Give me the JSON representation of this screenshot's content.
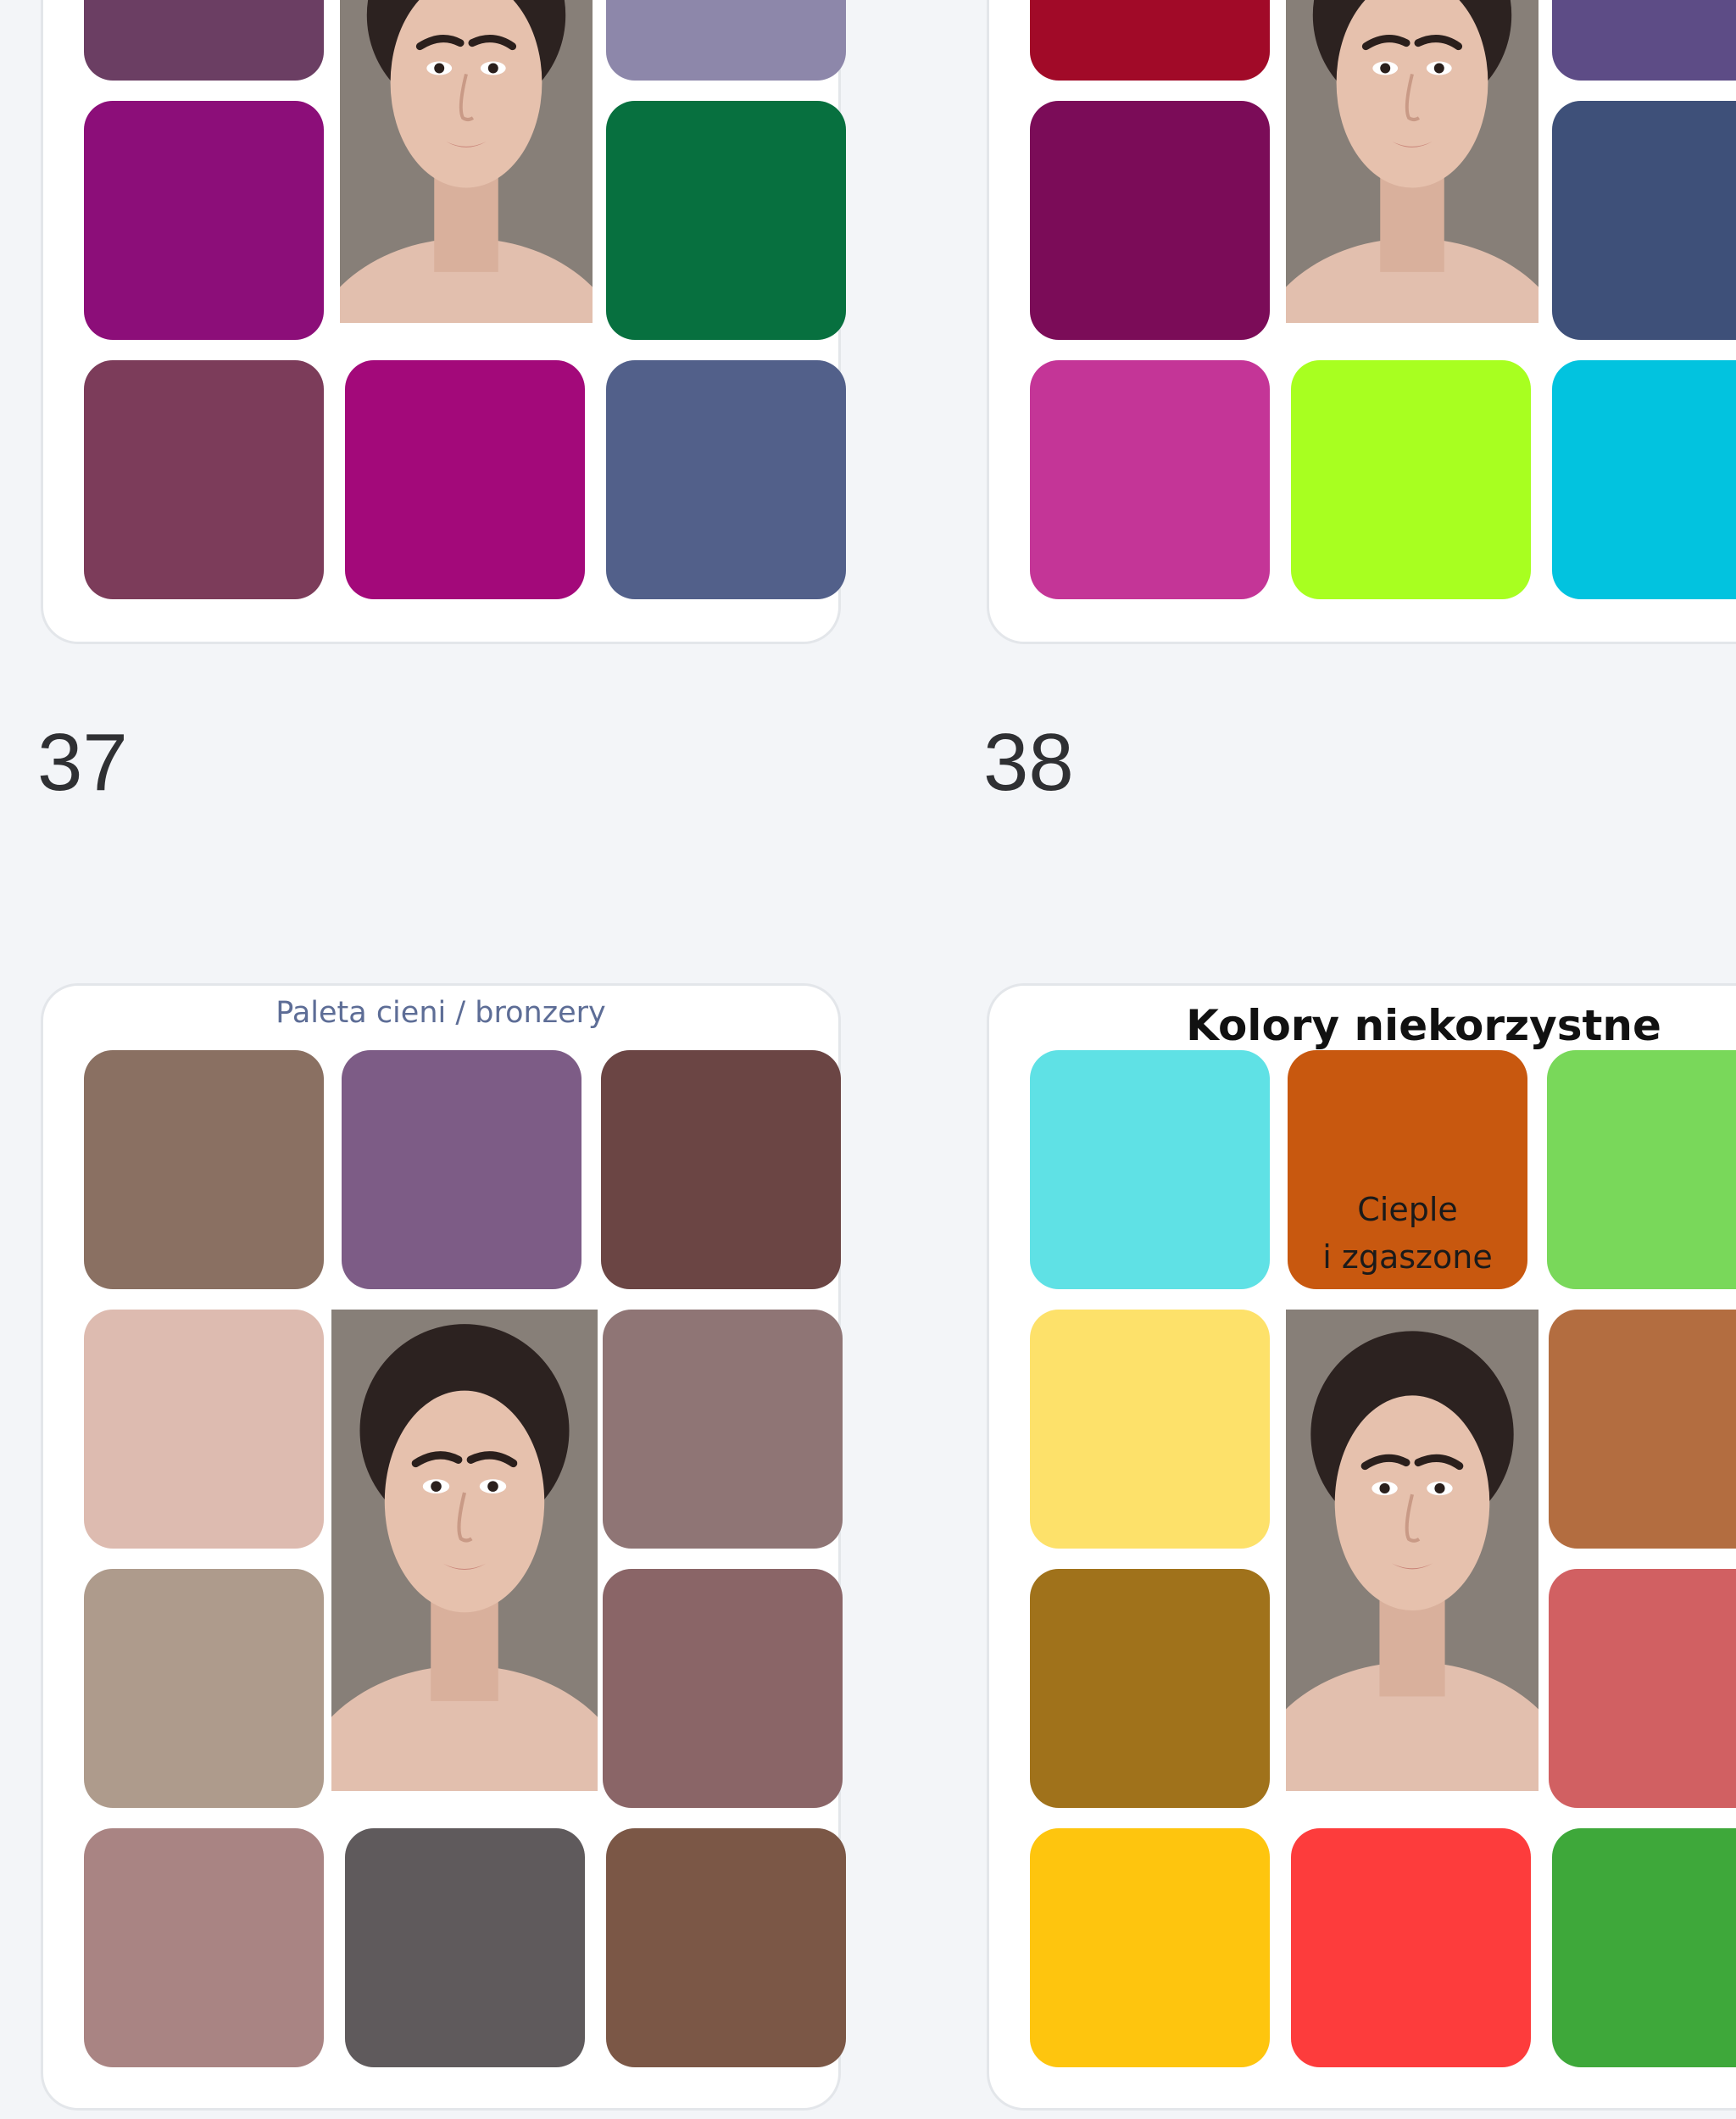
{
  "cards": {
    "top_left": {
      "swatches": [
        "#6b3e63",
        "#8d87aa",
        "#8c0e79",
        "#07703f",
        "#7c3c5a",
        "#a3097a",
        "#52608a"
      ]
    },
    "top_right": {
      "swatches": [
        "#a10a28",
        "#5d4c86",
        "#7b0c58",
        "#3e5079",
        "#c43597",
        "#a8ff20",
        "#02c3df"
      ]
    },
    "bottom_left": {
      "number": "37",
      "title": "Paleta cieni / bronzery",
      "swatches": [
        "#8a7062",
        "#7d5c86",
        "#6b4544",
        "#ddbbb0",
        "#8f7575",
        "#ae9b8c",
        "#8a6567",
        "#a98483",
        "#5f5a5c",
        "#7b5746"
      ]
    },
    "bottom_right": {
      "number": "38",
      "title": "Kolory niekorzystne",
      "swatch_label": "Cieple\ni zgaszone",
      "swatches": [
        "#5fe1e5",
        "#c8580f",
        "#79d85a",
        "#fde16a",
        "#b36d40",
        "#a0721b",
        "#d16062",
        "#fec50e",
        "#fd3c3c",
        "#3ea83a"
      ]
    }
  }
}
